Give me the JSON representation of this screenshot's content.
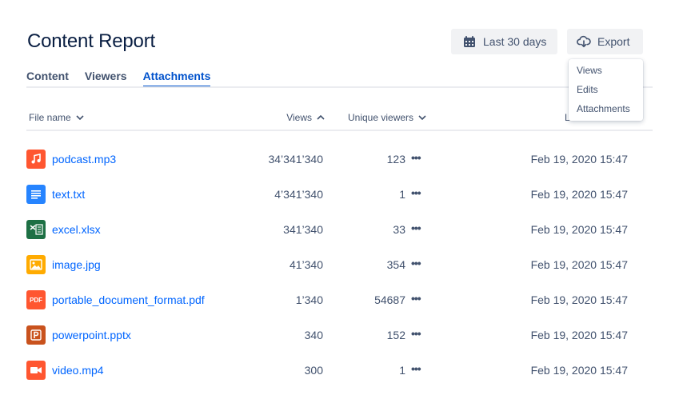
{
  "header": {
    "title": "Content Report",
    "date_range_label": "Last 30 days",
    "date_icon": "calendar-icon",
    "export_label": "Export",
    "export_icon": "cloud-download-icon"
  },
  "tabs": [
    {
      "label": "Content",
      "active": false
    },
    {
      "label": "Viewers",
      "active": false
    },
    {
      "label": "Attachments",
      "active": true
    }
  ],
  "export_menu": {
    "items": [
      "Views",
      "Edits",
      "Attachments"
    ]
  },
  "table": {
    "columns": {
      "file_name": "File name",
      "views": "Views",
      "unique_viewers": "Unique viewers",
      "last": "L"
    },
    "more_glyph": "•••",
    "rows": [
      {
        "icon": "audio-file-icon",
        "icon_color": "#ff5630",
        "name": "podcast.mp3",
        "views": "34’341’340",
        "unique": "123",
        "date": "Feb 19, 2020 15:47"
      },
      {
        "icon": "text-file-icon",
        "icon_color": "#2684ff",
        "name": "text.txt",
        "views": "4’341’340",
        "unique": "1",
        "date": "Feb 19, 2020 15:47"
      },
      {
        "icon": "excel-file-icon",
        "icon_color": "#1d7044",
        "name": "excel.xlsx",
        "views": "341’340",
        "unique": "33",
        "date": "Feb 19, 2020 15:47"
      },
      {
        "icon": "image-file-icon",
        "icon_color": "#ffab00",
        "name": "image.jpg",
        "views": "41’340",
        "unique": "354",
        "date": "Feb 19, 2020 15:47"
      },
      {
        "icon": "pdf-file-icon",
        "icon_color": "#ff5630",
        "name": "portable_document_format.pdf",
        "views": "1’340",
        "unique": "54687",
        "date": "Feb 19, 2020 15:47",
        "badge": "PDF"
      },
      {
        "icon": "powerpoint-file-icon",
        "icon_color": "#c9521d",
        "name": "powerpoint.pptx",
        "views": "340",
        "unique": "152",
        "date": "Feb 19, 2020 15:47"
      },
      {
        "icon": "video-file-icon",
        "icon_color": "#ff5630",
        "name": "video.mp4",
        "views": "300",
        "unique": "1",
        "date": "Feb 19, 2020 15:47"
      }
    ]
  }
}
